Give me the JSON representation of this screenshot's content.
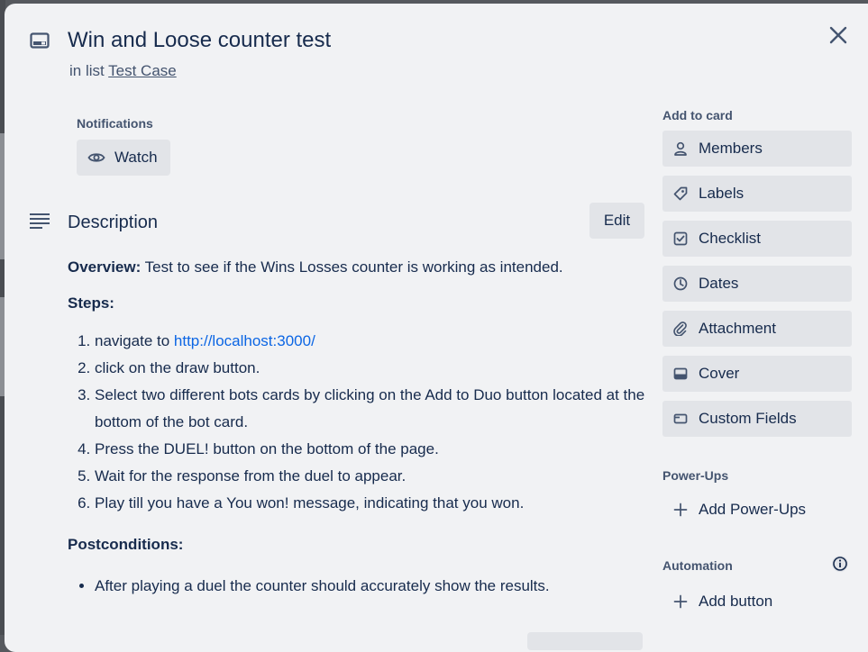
{
  "card": {
    "title": "Win and Loose counter test",
    "in_list_prefix": "in list",
    "list_name": "Test Case",
    "card_icon": "card-icon",
    "close_icon": "close-icon"
  },
  "notifications": {
    "label": "Notifications",
    "watch_label": "Watch",
    "watch_icon": "eye-icon"
  },
  "description": {
    "title": "Description",
    "icon": "description-lines-icon",
    "edit_label": "Edit",
    "overview_label": "Overview:",
    "overview_text": " Test to see if the Wins Losses counter is working as intended.",
    "steps_label": "Steps:",
    "step1_prefix": "navigate to ",
    "step1_link": "http://localhost:3000/",
    "steps": [
      "click on the draw button.",
      "Select two different bots cards by clicking on the Add to Duo button located at the bottom of the bot card.",
      "Press the DUEL! button on the bottom of the page.",
      "Wait for the response from the duel to appear.",
      "Play till you have a You won! message, indicating that you won."
    ],
    "postconditions_label": "Postconditions:",
    "postconditions": [
      "After playing a duel the counter should accurately show the results."
    ]
  },
  "sidebar": {
    "add_to_card_label": "Add to card",
    "buttons": [
      {
        "label": "Members",
        "icon": "person-icon"
      },
      {
        "label": "Labels",
        "icon": "tag-icon"
      },
      {
        "label": "Checklist",
        "icon": "checkbox-icon"
      },
      {
        "label": "Dates",
        "icon": "clock-icon"
      },
      {
        "label": "Attachment",
        "icon": "paperclip-icon"
      },
      {
        "label": "Cover",
        "icon": "cover-icon"
      },
      {
        "label": "Custom Fields",
        "icon": "custom-field-icon"
      }
    ],
    "powerups_label": "Power-Ups",
    "add_powerups_label": "Add Power-Ups",
    "automation_label": "Automation",
    "add_button_label": "Add button",
    "info_icon": "info-icon",
    "plus_icon": "plus-icon"
  },
  "colors": {
    "backdrop": "#56595e",
    "modal_bg": "#f1f2f4",
    "button_bg": "#e2e4e8",
    "text": "#172b4d",
    "subtle_text": "#44546f",
    "link": "#0c66e4"
  }
}
